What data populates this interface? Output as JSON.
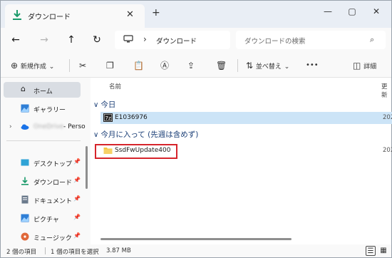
{
  "tab": {
    "title": "ダウンロード",
    "close": "✕",
    "new_tab": "+"
  },
  "window_controls": {
    "minimize": "—",
    "maximize": "▢",
    "close": "✕"
  },
  "nav": {
    "back": "←",
    "forward": "→",
    "up": "↑",
    "refresh": "↻"
  },
  "address": {
    "separator": "›",
    "location": "ダウンロード"
  },
  "search": {
    "placeholder": "ダウンロードの検索"
  },
  "commands": {
    "new": "新規作成",
    "new_chevron": "⌄",
    "sort": "並べ替え",
    "sort_chevron": "⌄",
    "more": "•••",
    "details": "詳細"
  },
  "sidebar": {
    "home": "ホーム",
    "gallery": "ギャラリー",
    "onedrive_suffix": "- Perso",
    "expander": "›",
    "pinned": [
      {
        "label": "デスクトップ",
        "icon": "desktop-icon"
      },
      {
        "label": "ダウンロード",
        "icon": "download-icon"
      },
      {
        "label": "ドキュメント",
        "icon": "document-icon"
      },
      {
        "label": "ピクチャ",
        "icon": "pictures-icon"
      },
      {
        "label": "ミュージック",
        "icon": "music-icon"
      }
    ],
    "pin_glyph": "📌"
  },
  "content": {
    "col_name": "名前",
    "col_date": "更新",
    "groups": [
      {
        "label": "今日",
        "chevron": "∨"
      },
      {
        "label": "今月に入って (先週は含めず)",
        "chevron": "∨"
      }
    ],
    "files": [
      {
        "name": "E1036976",
        "date": "202",
        "icon": "7z-archive-icon",
        "selected": true
      },
      {
        "name": "SsdFwUpdate400",
        "date": "202",
        "icon": "folder-icon",
        "selected": false
      }
    ]
  },
  "status": {
    "count": "2 個の項目",
    "selection": "1 個の項目を選択",
    "size": "3.87 MB"
  },
  "colors": {
    "accent": "#1b3f77",
    "selection": "#cce4f7",
    "highlight_box": "#d6242b",
    "folder": "#f4c542"
  }
}
